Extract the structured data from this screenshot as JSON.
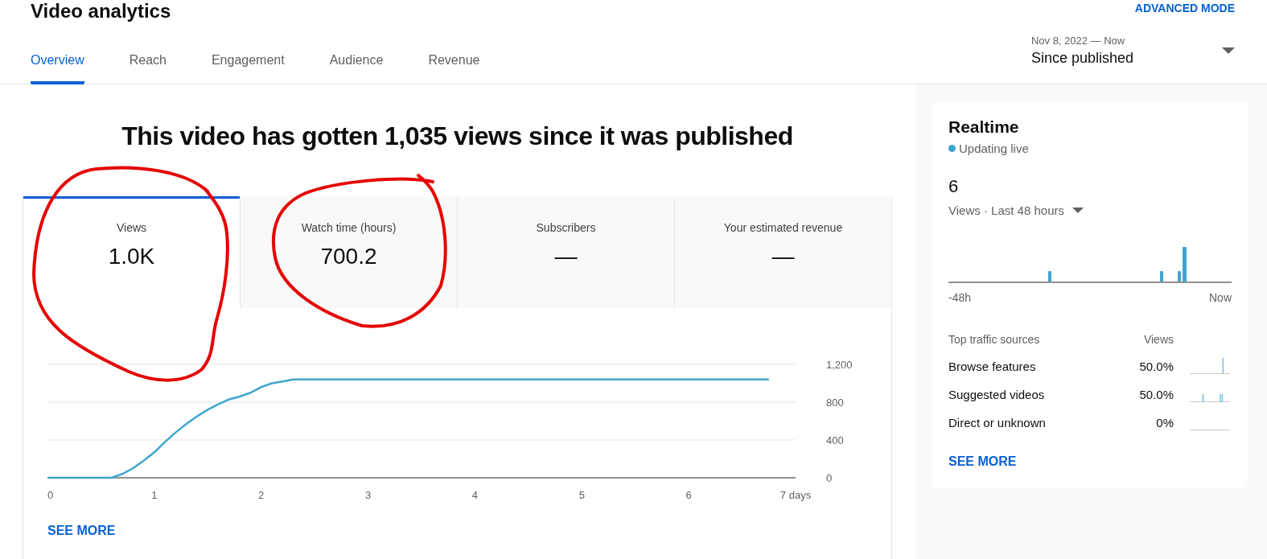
{
  "header": {
    "title": "Video analytics",
    "advanced_mode": "ADVANCED MODE"
  },
  "tabs": [
    {
      "label": "Overview",
      "selected": true
    },
    {
      "label": "Reach",
      "selected": false
    },
    {
      "label": "Engagement",
      "selected": false
    },
    {
      "label": "Audience",
      "selected": false
    },
    {
      "label": "Revenue",
      "selected": false
    }
  ],
  "date_range": {
    "range": "Nov 8, 2022 — Now",
    "label": "Since published"
  },
  "headline": "This video has gotten 1,035 views since it was published",
  "metrics": [
    {
      "label": "Views",
      "value": "1.0K",
      "selected": true
    },
    {
      "label": "Watch time (hours)",
      "value": "700.2",
      "selected": false
    },
    {
      "label": "Subscribers",
      "value": "—",
      "selected": false
    },
    {
      "label": "Your estimated revenue",
      "value": "—",
      "selected": false
    }
  ],
  "overview_chart": {
    "chart_data": {
      "type": "line",
      "x": [
        0,
        0.6,
        0.7,
        0.8,
        0.9,
        1.0,
        1.1,
        1.2,
        1.3,
        1.4,
        1.5,
        1.6,
        1.7,
        1.8,
        1.9,
        2.0,
        2.1,
        2.2,
        2.3,
        3,
        4,
        5,
        6,
        6.75
      ],
      "series": [
        {
          "color": "#3ea6ce",
          "values": [
            0,
            0,
            40,
            100,
            180,
            270,
            380,
            480,
            570,
            650,
            720,
            780,
            830,
            860,
            900,
            960,
            1000,
            1020,
            1040,
            1040,
            1040,
            1040,
            1040,
            1040
          ]
        }
      ],
      "xlim": [
        0,
        7
      ],
      "ylim": [
        0,
        1200
      ],
      "xticks": [
        0,
        1,
        2,
        3,
        4,
        5,
        6,
        {
          "value": 7,
          "label": "7 days"
        }
      ],
      "yticks": [
        0,
        400,
        800,
        {
          "value": 1200,
          "label": "1,200"
        }
      ]
    },
    "see_more": "SEE MORE"
  },
  "realtime": {
    "title": "Realtime",
    "status": "Updating live",
    "count": "6",
    "period": "Views · Last 48 hours",
    "axis_start": "-48h",
    "axis_end": "Now",
    "sources_heading": "Top traffic sources",
    "views_heading": "Views",
    "sources": [
      {
        "name": "Browse features",
        "share": "50.0%"
      },
      {
        "name": "Suggested videos",
        "share": "50.0%"
      },
      {
        "name": "Direct or unknown",
        "share": "0%"
      }
    ],
    "see_more": "SEE MORE"
  }
}
